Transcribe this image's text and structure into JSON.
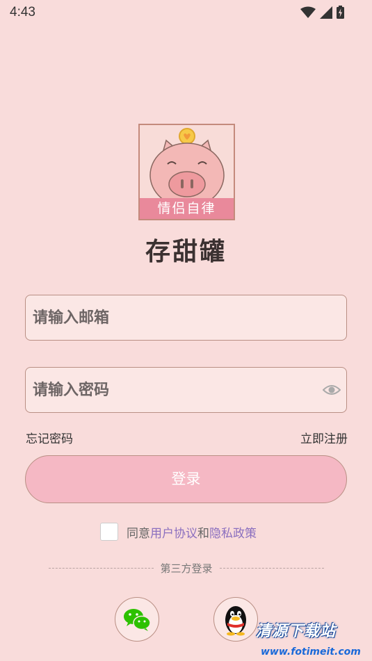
{
  "status_bar": {
    "time": "4:43",
    "icons": [
      "wifi-icon",
      "signal-icon",
      "battery-icon"
    ]
  },
  "logo": {
    "band_text": "情侣自律",
    "icon": "piggy-bank-icon"
  },
  "app_title": "存甜罐",
  "email_field": {
    "placeholder": "请输入邮箱",
    "value": ""
  },
  "password_field": {
    "placeholder": "请输入密码",
    "value": "",
    "toggle_icon": "eye-icon"
  },
  "links": {
    "forgot_password": "忘记密码",
    "register": "立即注册"
  },
  "login_button": {
    "label": "登录"
  },
  "agreement": {
    "checked": false,
    "prefix": "同意",
    "user_agreement": "用户协议",
    "conjunction": "和",
    "privacy_policy": "隐私政策",
    "link_color": "#8b6fbf"
  },
  "third_party": {
    "label": "第三方登录",
    "providers": [
      {
        "name": "wechat",
        "icon": "wechat-icon"
      },
      {
        "name": "qq",
        "icon": "qq-penguin-icon"
      }
    ]
  },
  "watermark": {
    "line1": "清源下载站",
    "line2": "www.fotimeit.com"
  },
  "colors": {
    "background": "#f9dcdb",
    "button": "#f5b8c4",
    "border": "#b98f84",
    "logo_band": "#e9899b"
  }
}
